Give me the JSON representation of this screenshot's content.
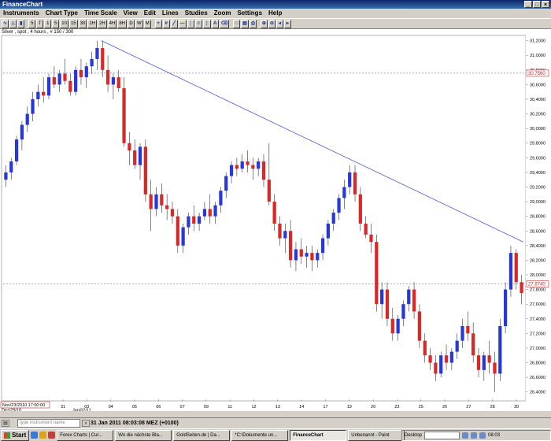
{
  "window": {
    "title": "FinanceChart"
  },
  "menu": [
    "Instruments",
    "Chart Type",
    "Time Scale",
    "View",
    "Edit",
    "Lines",
    "Studies",
    "Zoom",
    "Settings",
    "Help"
  ],
  "toolbar": [
    "5",
    "T",
    "1",
    "5",
    "10",
    "15",
    "30",
    "1H",
    "2H",
    "4H",
    "8H",
    "D",
    "W",
    "M"
  ],
  "chart": {
    "title": "Silver , spot , 4 hours , # 150 / 300",
    "price_tags": [
      "30.7560",
      "27.8740"
    ],
    "cursor_date": "Nov/23/2010 17:00:00"
  },
  "chart_data": {
    "type": "candlestick",
    "ylim": [
      26.3,
      31.25
    ],
    "yticks": [
      "31,2000",
      "31,0000",
      "30,8000",
      "30,6000",
      "30,4000",
      "30,2000",
      "30,0000",
      "29,8000",
      "29,6000",
      "29,4000",
      "29,2000",
      "29,0000",
      "28,8000",
      "28,6000",
      "28,4000",
      "28,2000",
      "28,0000",
      "27,8000",
      "27,6000",
      "27,4000",
      "27,2000",
      "27,0000",
      "26,8000",
      "26,6000",
      "26,4000"
    ],
    "xticks": [
      "31",
      "03",
      "04",
      "05",
      "06",
      "07",
      "09",
      "11",
      "12",
      "13",
      "14",
      "17",
      "19",
      "20",
      "23",
      "25",
      "26",
      "27",
      "28",
      "30"
    ],
    "xmonths": [
      "Dez/29/10",
      "Jan/02/11"
    ],
    "hlines": [
      30.756,
      27.874
    ],
    "trendline": [
      [
        30.2,
        31.2
      ],
      [
        28.45,
        27.9
      ]
    ],
    "candles": [
      [
        29.3,
        29.5,
        29.2,
        29.4
      ],
      [
        29.4,
        29.6,
        29.3,
        29.55
      ],
      [
        29.55,
        29.9,
        29.5,
        29.85
      ],
      [
        29.85,
        30.1,
        29.7,
        30.05
      ],
      [
        30.05,
        30.3,
        29.95,
        30.2
      ],
      [
        30.2,
        30.5,
        30.1,
        30.4
      ],
      [
        30.4,
        30.6,
        30.3,
        30.5
      ],
      [
        30.5,
        30.7,
        30.35,
        30.45
      ],
      [
        30.45,
        30.75,
        30.4,
        30.7
      ],
      [
        30.7,
        30.85,
        30.55,
        30.6
      ],
      [
        30.6,
        30.8,
        30.5,
        30.75
      ],
      [
        30.75,
        30.95,
        30.6,
        30.65
      ],
      [
        30.65,
        30.75,
        30.45,
        30.5
      ],
      [
        30.5,
        30.85,
        30.45,
        30.8
      ],
      [
        30.8,
        30.95,
        30.6,
        30.7
      ],
      [
        30.7,
        30.9,
        30.55,
        30.85
      ],
      [
        30.85,
        31.05,
        30.75,
        30.95
      ],
      [
        30.95,
        31.2,
        30.8,
        31.1
      ],
      [
        31.1,
        31.2,
        30.7,
        30.8
      ],
      [
        30.8,
        31.0,
        30.5,
        30.6
      ],
      [
        30.6,
        30.75,
        30.4,
        30.7
      ],
      [
        30.7,
        30.8,
        30.5,
        30.55
      ],
      [
        30.55,
        30.7,
        29.75,
        29.8
      ],
      [
        29.8,
        29.95,
        29.5,
        29.7
      ],
      [
        29.7,
        29.85,
        29.45,
        29.5
      ],
      [
        29.5,
        29.8,
        29.3,
        29.75
      ],
      [
        29.75,
        29.85,
        29.0,
        29.1
      ],
      [
        29.1,
        29.3,
        28.6,
        28.9
      ],
      [
        28.9,
        29.2,
        28.8,
        29.1
      ],
      [
        29.1,
        29.25,
        28.85,
        28.95
      ],
      [
        28.95,
        29.1,
        28.75,
        28.9
      ],
      [
        28.9,
        29.0,
        28.7,
        28.8
      ],
      [
        28.8,
        28.9,
        28.3,
        28.4
      ],
      [
        28.4,
        28.7,
        28.3,
        28.65
      ],
      [
        28.65,
        28.85,
        28.55,
        28.8
      ],
      [
        28.8,
        28.95,
        28.6,
        28.7
      ],
      [
        28.7,
        28.85,
        28.6,
        28.8
      ],
      [
        28.8,
        29.0,
        28.75,
        28.9
      ],
      [
        28.9,
        29.1,
        28.7,
        28.8
      ],
      [
        28.8,
        29.0,
        28.7,
        28.95
      ],
      [
        28.95,
        29.2,
        28.85,
        29.15
      ],
      [
        29.15,
        29.4,
        29.05,
        29.35
      ],
      [
        29.35,
        29.55,
        29.25,
        29.5
      ],
      [
        29.5,
        29.6,
        29.35,
        29.45
      ],
      [
        29.45,
        29.65,
        29.4,
        29.55
      ],
      [
        29.55,
        29.7,
        29.4,
        29.5
      ],
      [
        29.5,
        29.6,
        29.3,
        29.45
      ],
      [
        29.45,
        29.6,
        29.35,
        29.55
      ],
      [
        29.55,
        29.65,
        29.2,
        29.3
      ],
      [
        29.3,
        29.8,
        28.95,
        29.0
      ],
      [
        29.0,
        29.1,
        28.6,
        28.7
      ],
      [
        28.7,
        28.8,
        28.4,
        28.5
      ],
      [
        28.5,
        28.7,
        28.3,
        28.6
      ],
      [
        28.6,
        28.75,
        28.1,
        28.2
      ],
      [
        28.2,
        28.45,
        28.05,
        28.35
      ],
      [
        28.35,
        28.5,
        28.15,
        28.25
      ],
      [
        28.25,
        28.4,
        28.1,
        28.3
      ],
      [
        28.3,
        28.4,
        28.05,
        28.2
      ],
      [
        28.2,
        28.35,
        28.1,
        28.3
      ],
      [
        28.3,
        28.55,
        28.2,
        28.5
      ],
      [
        28.5,
        28.75,
        28.4,
        28.7
      ],
      [
        28.7,
        28.9,
        28.6,
        28.85
      ],
      [
        28.85,
        29.1,
        28.75,
        29.05
      ],
      [
        29.05,
        29.3,
        28.9,
        29.2
      ],
      [
        29.2,
        29.5,
        29.1,
        29.4
      ],
      [
        29.4,
        29.5,
        29.0,
        29.1
      ],
      [
        29.1,
        29.2,
        28.6,
        28.7
      ],
      [
        28.7,
        28.8,
        28.5,
        28.55
      ],
      [
        28.55,
        28.7,
        28.3,
        28.45
      ],
      [
        28.45,
        28.55,
        27.5,
        27.6
      ],
      [
        27.6,
        27.9,
        27.4,
        27.8
      ],
      [
        27.8,
        27.9,
        27.3,
        27.4
      ],
      [
        27.4,
        27.55,
        27.1,
        27.2
      ],
      [
        27.2,
        27.45,
        27.1,
        27.4
      ],
      [
        27.4,
        27.65,
        27.3,
        27.6
      ],
      [
        27.6,
        27.85,
        27.5,
        27.8
      ],
      [
        27.8,
        27.9,
        27.4,
        27.5
      ],
      [
        27.5,
        27.6,
        27.0,
        27.1
      ],
      [
        27.1,
        27.2,
        26.8,
        26.9
      ],
      [
        26.9,
        27.0,
        26.7,
        26.8
      ],
      [
        26.8,
        26.9,
        26.55,
        26.65
      ],
      [
        26.65,
        26.95,
        26.6,
        26.9
      ],
      [
        26.9,
        27.05,
        26.7,
        26.8
      ],
      [
        26.8,
        27.0,
        26.7,
        26.95
      ],
      [
        26.95,
        27.2,
        26.85,
        27.1
      ],
      [
        27.1,
        27.4,
        27.0,
        27.3
      ],
      [
        27.3,
        27.5,
        27.1,
        27.2
      ],
      [
        27.2,
        27.35,
        26.8,
        26.9
      ],
      [
        26.9,
        27.0,
        26.6,
        26.7
      ],
      [
        26.7,
        26.95,
        26.55,
        26.9
      ],
      [
        26.9,
        27.1,
        26.65,
        26.8
      ],
      [
        26.8,
        26.95,
        26.4,
        26.65
      ],
      [
        26.65,
        27.4,
        26.55,
        27.3
      ],
      [
        27.3,
        27.9,
        27.2,
        27.8
      ],
      [
        27.8,
        28.4,
        27.7,
        28.3
      ],
      [
        28.3,
        28.35,
        27.8,
        27.9
      ],
      [
        27.9,
        28.0,
        27.6,
        27.75
      ]
    ]
  },
  "status": {
    "search_placeholder": "type instrument name",
    "time": "31 Jan 2011 08:03:08  MEZ (+0100)"
  },
  "taskbar": {
    "start": "Start",
    "tasks": [
      "Forex Charts | Cur...",
      "Wo die nächste Bla...",
      "GoldSeiten.de | Da...",
      "*C:\\Dokumente un...",
      "FinanceChart",
      "Unbenannt - Paint"
    ],
    "tray_label": "Desktop",
    "clock": "08:03"
  }
}
